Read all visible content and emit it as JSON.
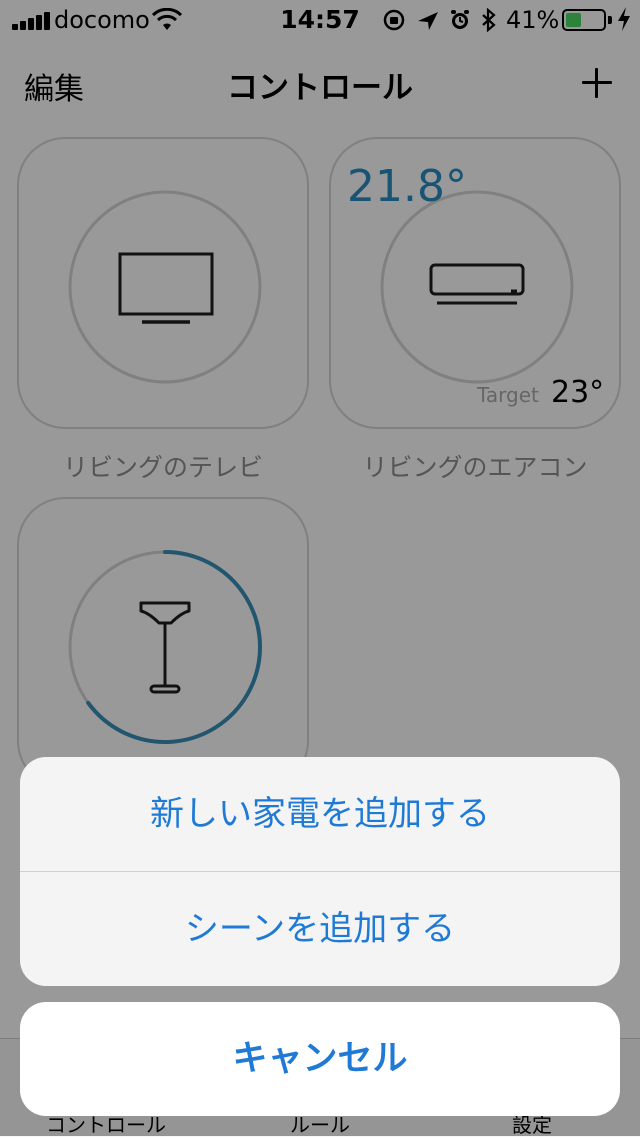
{
  "status_bar": {
    "carrier": "docomo",
    "time": "14:57",
    "battery_percent": "41%",
    "battery_level": 0.41,
    "icons": [
      "signal-icon",
      "wifi-icon",
      "rotation-lock-icon",
      "location-icon",
      "alarm-icon",
      "bluetooth-icon",
      "battery-icon",
      "charging-icon"
    ]
  },
  "nav": {
    "edit_label": "編集",
    "title": "コントロール",
    "add_icon": "plus-icon"
  },
  "devices": [
    {
      "name": "リビングのテレビ",
      "icon": "tv-icon"
    },
    {
      "name": "リビングのエアコン",
      "icon": "air-conditioner-icon",
      "current_temp": "21.8°",
      "target_label": "Target",
      "target_temp": "23°"
    },
    {
      "name": "",
      "icon": "floor-lamp-icon",
      "level": 0.65
    }
  ],
  "tab_bar": {
    "tabs": [
      {
        "label": "コントロール"
      },
      {
        "label": "ルール"
      },
      {
        "label": "設定"
      }
    ]
  },
  "action_sheet": {
    "actions": [
      {
        "label": "新しい家電を追加する"
      },
      {
        "label": "シーンを追加する"
      }
    ],
    "cancel_label": "キャンセル"
  },
  "colors": {
    "accent": "#1f7ad6",
    "temperature": "#2b8cc4",
    "lamp_ring": "#3a8fb7",
    "battery": "#4cd964",
    "dim_overlay": "rgba(0,0,0,0.40)"
  }
}
